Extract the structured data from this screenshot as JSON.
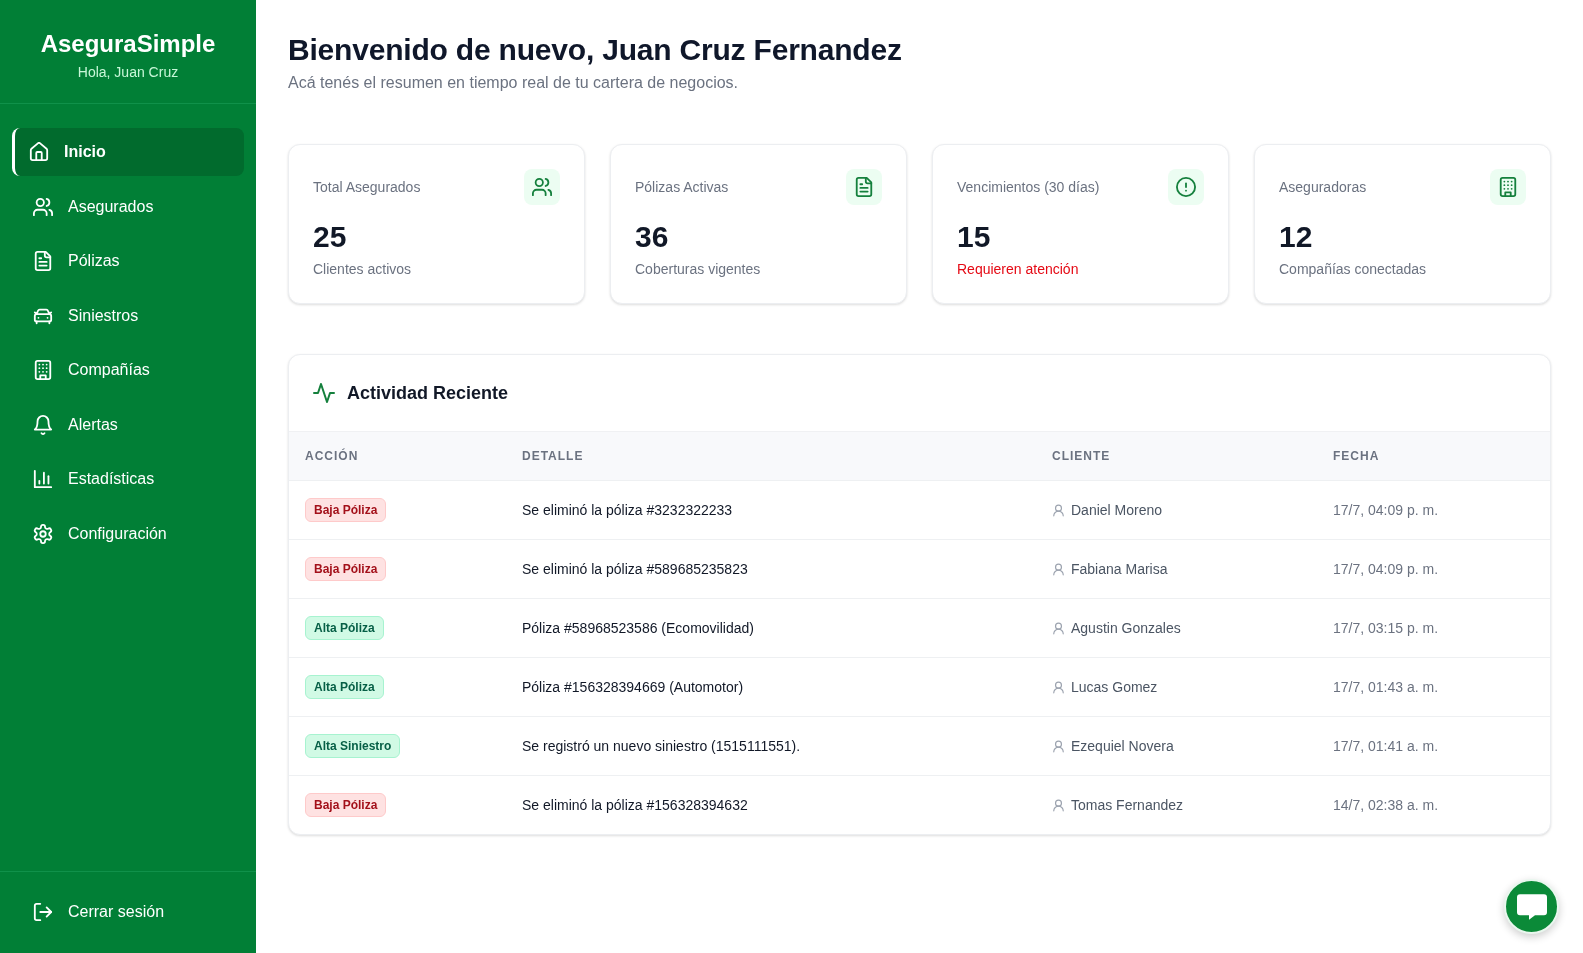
{
  "sidebar": {
    "brand": "AseguraSimple",
    "greeting": "Hola, Juan Cruz",
    "items": [
      {
        "label": "Inicio",
        "selected": true
      },
      {
        "label": "Asegurados",
        "selected": false
      },
      {
        "label": "Pólizas",
        "selected": false
      },
      {
        "label": "Siniestros",
        "selected": false
      },
      {
        "label": "Compañías",
        "selected": false
      },
      {
        "label": "Alertas",
        "selected": false
      },
      {
        "label": "Estadísticas",
        "selected": false
      },
      {
        "label": "Configuración",
        "selected": false
      }
    ],
    "logout": "Cerrar sesión"
  },
  "header": {
    "title": "Bienvenido de nuevo, Juan Cruz Fernandez",
    "subtitle": "Acá tenés el resumen en tiempo real de tu cartera de negocios."
  },
  "stats": [
    {
      "label": "Total Asegurados",
      "value": "25",
      "note": "Clientes activos",
      "alert": false
    },
    {
      "label": "Pólizas Activas",
      "value": "36",
      "note": "Coberturas vigentes",
      "alert": false
    },
    {
      "label": "Vencimientos (30 días)",
      "value": "15",
      "note": "Requieren atención",
      "alert": true
    },
    {
      "label": "Aseguradoras",
      "value": "12",
      "note": "Compañías conectadas",
      "alert": false
    }
  ],
  "activity": {
    "title": "Actividad Reciente",
    "columns": [
      "ACCIÓN",
      "DETALLE",
      "CLIENTE",
      "FECHA"
    ],
    "rows": [
      {
        "action": {
          "label": "Baja Póliza",
          "kind": "removal"
        },
        "detail": "Se eliminó la póliza #3232322233",
        "client": "Daniel Moreno",
        "date": "17/7, 04:09 p. m."
      },
      {
        "action": {
          "label": "Baja Póliza",
          "kind": "removal"
        },
        "detail": "Se eliminó la póliza #589685235823",
        "client": "Fabiana Marisa",
        "date": "17/7, 04:09 p. m."
      },
      {
        "action": {
          "label": "Alta Póliza",
          "kind": "addition"
        },
        "detail": "Póliza #58968523586 (Ecomovilidad)",
        "client": "Agustin Gonzales",
        "date": "17/7, 03:15 p. m."
      },
      {
        "action": {
          "label": "Alta Póliza",
          "kind": "addition"
        },
        "detail": "Póliza #156328394669 (Automotor)",
        "client": "Lucas Gomez",
        "date": "17/7, 01:43 a. m."
      },
      {
        "action": {
          "label": "Alta Siniestro",
          "kind": "addition"
        },
        "detail": "Se registró un nuevo siniestro (1515111551).",
        "client": "Ezequiel Novera",
        "date": "17/7, 01:41 a. m."
      },
      {
        "action": {
          "label": "Baja Póliza",
          "kind": "removal"
        },
        "detail": "Se eliminó la póliza #156328394632",
        "client": "Tomas Fernandez",
        "date": "14/7, 02:38 a. m."
      }
    ]
  }
}
